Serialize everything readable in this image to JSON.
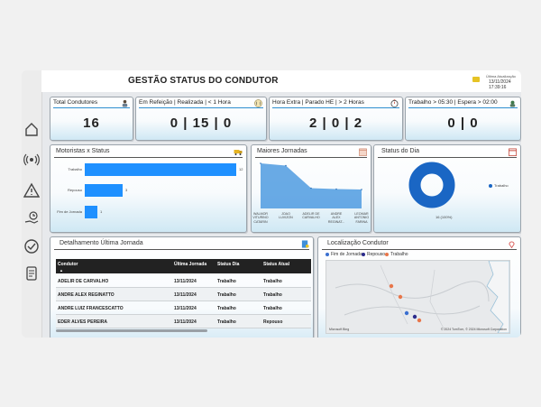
{
  "header": {
    "title": "GESTÃO STATUS DO CONDUTOR",
    "update_label": "Última Atualização",
    "update_value": "13/11/2024 17:39:16"
  },
  "kpis": [
    {
      "title": "Total Condutores",
      "value": "16"
    },
    {
      "title": "Em Refeição | Realizada | < 1 Hora",
      "value": "0 | 15 | 0"
    },
    {
      "title": "Hora Extra | Parado HE | > 2 Horas",
      "value": "2 | 0 | 2"
    },
    {
      "title": "Trabalho > 05:30 | Espera > 02:00",
      "value": "0 | 0"
    }
  ],
  "motoristas": {
    "title": "Motoristas x Status",
    "chart_data": {
      "type": "bar",
      "orientation": "horizontal",
      "categories": [
        "Trabalho",
        "Repouso",
        "Fim de Jornada"
      ],
      "values": [
        12,
        3,
        1
      ],
      "color": "#1e90ff"
    }
  },
  "jornadas": {
    "title": "Maiores Jornadas",
    "chart_data": {
      "type": "area",
      "categories": [
        "WALMOR VITURINO CATARIN",
        "JOAO LUVIZON",
        "ADELIR DE CARVALHO",
        "ANDRE ALEX REGINAT...",
        "LEOMAR ANTONIO FARINA"
      ],
      "labels": [
        [
          "WALMOR",
          "VITURINO",
          "CATARIN"
        ],
        [
          "JOAO",
          "LUVIZON"
        ],
        [
          "ADELIR DE",
          "CARVALHO"
        ],
        [
          "ANDRE",
          "ALEX",
          "REGINAT..."
        ],
        [
          "LEOMAR",
          "ANTONIO",
          "FARINA"
        ]
      ],
      "values": [
        100,
        95,
        45,
        43,
        42
      ],
      "color": "#4f9be0"
    }
  },
  "status_dia": {
    "title": "Status do Dia",
    "chart_data": {
      "type": "pie",
      "slices": [
        {
          "label": "Trabalho",
          "value": 16,
          "percent": 100
        }
      ],
      "donut": true
    },
    "legend": "Trabalho",
    "data_label": "16 (100%)",
    "color": "#1a66c4"
  },
  "tabela": {
    "title": "Detalhamento Última Jornada",
    "columns": [
      "Condutor",
      "Última Jornada",
      "Status Dia",
      "Status Atual"
    ],
    "rows": [
      [
        "ADELIR DE CARVALHO",
        "13/11/2024",
        "Trabalho",
        "Trabalho"
      ],
      [
        "ANDRE ALEX REGINATTO",
        "13/11/2024",
        "Trabalho",
        "Trabalho"
      ],
      [
        "ANDRE LUIZ FRANCESCATTO",
        "13/11/2024",
        "Trabalho",
        "Trabalho"
      ],
      [
        "EDER ALVES PEREIRA",
        "13/11/2024",
        "Trabalho",
        "Repouso"
      ]
    ]
  },
  "localizacao": {
    "title": "Localização Condutor",
    "legend": [
      {
        "label": "Fim de Jornada",
        "color": "#3a6fd0"
      },
      {
        "label": "Repouso",
        "color": "#2b2b8c"
      },
      {
        "label": "Trabalho",
        "color": "#e8764a"
      }
    ],
    "footer": "© 2024 TomTom, © 2024 Microsoft Corporation",
    "brand": "Microsoft Bing"
  }
}
